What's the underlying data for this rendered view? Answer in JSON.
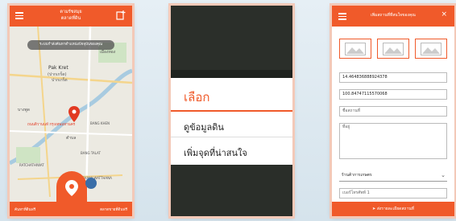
{
  "phone1": {
    "header_title_line1": "ตามรัชสมุย",
    "header_title_line2": "ตลาดที่ดิน",
    "toast": "ระบบกำลังค้นหาตำแหน่งปัจจุบันของคุณ",
    "map_labels": [
      "Pak Kret",
      "(ปากเกร็ด)",
      "ปากเกร็ด",
      "เมืองทอง",
      "บางพูด",
      "BANG TALAT",
      "ตำบล",
      "RATCHATHIWAT",
      "BANG KHEN",
      "THAWI WATTHANA"
    ],
    "red_label": "ถนนติวานนท์ กรุงเทพมหานคร",
    "bottom_left": "ค้นหาที่ดินฟรี",
    "bottom_right": "ตลาดขายที่ดินฟรี"
  },
  "phone2": {
    "sheet_title": "เลือก",
    "items": [
      "ดูข้อมูลดิน",
      "เพิ่มจุดที่น่าสนใจ"
    ]
  },
  "phone3": {
    "header_title": "เพิ่มสถานที่ที่สนใจของคุณ",
    "close": "×",
    "lat": "14.464836888924378",
    "lng": "100.84747115570068",
    "name_placeholder": "ชื่อสถานที่",
    "address_placeholder": "ที่อยู่",
    "category": "ร้านค้าการเกษตร",
    "phone_placeholder": "เบอร์โทรศัพท์ 1",
    "submit": "ส่งรายละเอียดสถานที่"
  },
  "colors": {
    "accent": "#f05a2a"
  }
}
